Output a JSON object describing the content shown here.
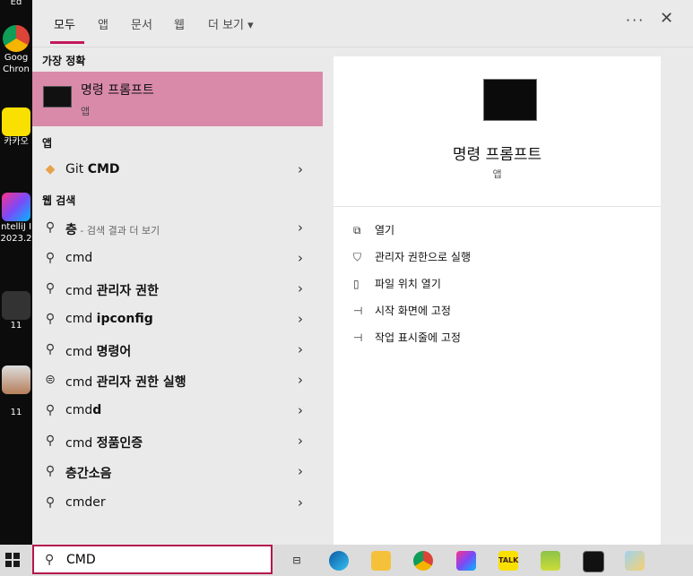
{
  "desktop": {
    "icons": [
      {
        "label": "Goog",
        "label2": "Chron"
      },
      {
        "label": "카카오"
      },
      {
        "label": "ntelliJ I",
        "label2": "2023.2"
      },
      {
        "label": "11"
      },
      {
        "label": "11"
      }
    ],
    "top_label": "Ed"
  },
  "tabs": [
    {
      "label": "모두"
    },
    {
      "label": "앱"
    },
    {
      "label": "문서"
    },
    {
      "label": "웹"
    },
    {
      "label": "더 보기 ▾"
    }
  ],
  "header": {
    "more": "···",
    "close": "✕"
  },
  "sections": {
    "best_match": "가장 정확",
    "apps": "앱",
    "web": "웹 검색"
  },
  "best_match": {
    "title": "명령 프롬프트",
    "subtitle": "앱"
  },
  "app_results": [
    {
      "prefix": "Git ",
      "bold": "CMD",
      "icon": "git-icon"
    }
  ],
  "web_results": [
    {
      "prefix": "",
      "bold": "층",
      "hint": " - 검색 결과 더 보기",
      "icon": "search-icon"
    },
    {
      "prefix": "cmd",
      "bold": "",
      "hint": "",
      "icon": "search-icon"
    },
    {
      "prefix": "cmd ",
      "bold": "관리자 권한",
      "hint": "",
      "icon": "search-icon"
    },
    {
      "prefix": "cmd ",
      "bold": "ipconfig",
      "hint": "",
      "icon": "search-icon"
    },
    {
      "prefix": "cmd ",
      "bold": "명령어",
      "hint": "",
      "icon": "search-icon"
    },
    {
      "prefix": "cmd ",
      "bold": "관리자 권한 실행",
      "hint": "",
      "icon": "chat-icon"
    },
    {
      "prefix": "cmd",
      "bold": "d",
      "hint": "",
      "icon": "search-icon"
    },
    {
      "prefix": "cmd ",
      "bold": "정품인증",
      "hint": "",
      "icon": "search-icon"
    },
    {
      "prefix": "",
      "bold": "층간소음",
      "hint": "",
      "icon": "search-icon"
    },
    {
      "prefix": "cmder",
      "bold": "",
      "hint": "",
      "icon": "search-icon"
    }
  ],
  "detail": {
    "title": "명령 프롬프트",
    "subtitle": "앱",
    "actions": [
      {
        "label": "열기",
        "icon": "open-icon"
      },
      {
        "label": "관리자 권한으로 실행",
        "icon": "shield-icon"
      },
      {
        "label": "파일 위치 열기",
        "icon": "file-location-icon"
      },
      {
        "label": "시작 화면에 고정",
        "icon": "pin-icon"
      },
      {
        "label": "작업 표시줄에 고정",
        "icon": "pin-icon"
      }
    ]
  },
  "search": {
    "value": "CMD"
  },
  "taskbar": {
    "apps": [
      "task-view-icon",
      "edge-icon",
      "file-explorer-icon",
      "chrome-icon",
      "intellij-icon",
      "kakaotalk-icon",
      "notepad-icon",
      "terminal-icon",
      "paint-icon"
    ],
    "kakao_text": "TALK"
  },
  "colors": {
    "accent": "#c2185b",
    "highlight": "#d98aa8",
    "panel": "#ebeaea"
  }
}
